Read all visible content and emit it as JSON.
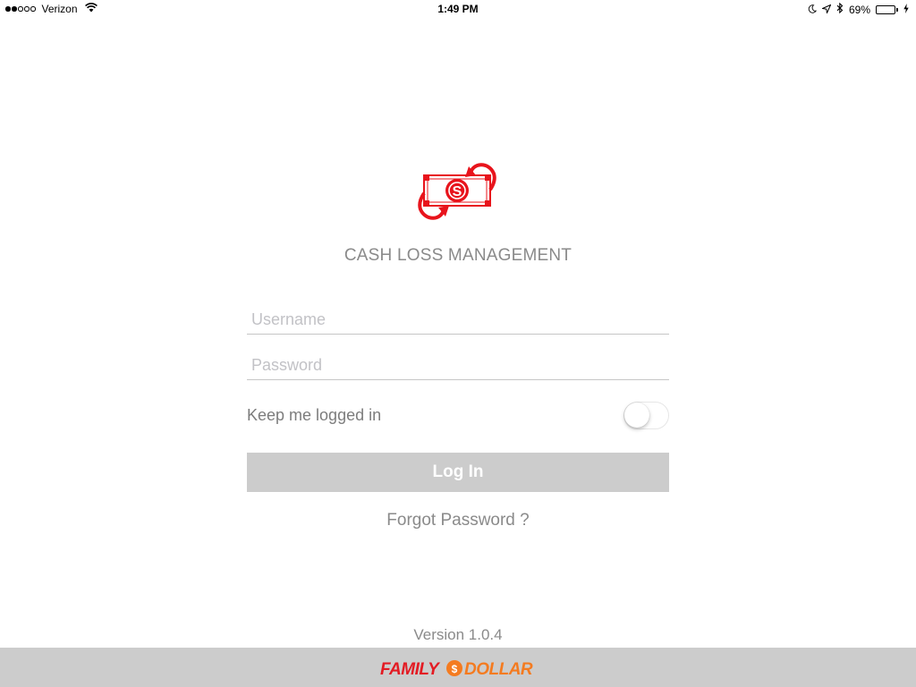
{
  "status_bar": {
    "carrier": "Verizon",
    "time": "1:49 PM",
    "battery_percent": "69%",
    "battery_level": 0.69,
    "signal_bars_filled": 2,
    "signal_bars_total": 5,
    "icons": [
      "wifi-icon",
      "moon-icon",
      "location-icon",
      "bluetooth-icon",
      "battery-icon",
      "charging-icon"
    ]
  },
  "app": {
    "logo_icon": "money-transfer-icon",
    "title": "CASH LOSS MANAGEMENT",
    "accent_color": "#e8141c"
  },
  "form": {
    "username_placeholder": "Username",
    "username_value": "",
    "password_placeholder": "Password",
    "password_value": "",
    "keep_logged_in_label": "Keep me logged in",
    "keep_logged_in": false,
    "login_label": "Log In",
    "forgot_label": "Forgot Password ?"
  },
  "footer": {
    "version": "Version 1.0.4",
    "brand": "FAMILY DOLLAR",
    "brand_color": "#f47b20",
    "brand_accent": "#e31b23"
  }
}
